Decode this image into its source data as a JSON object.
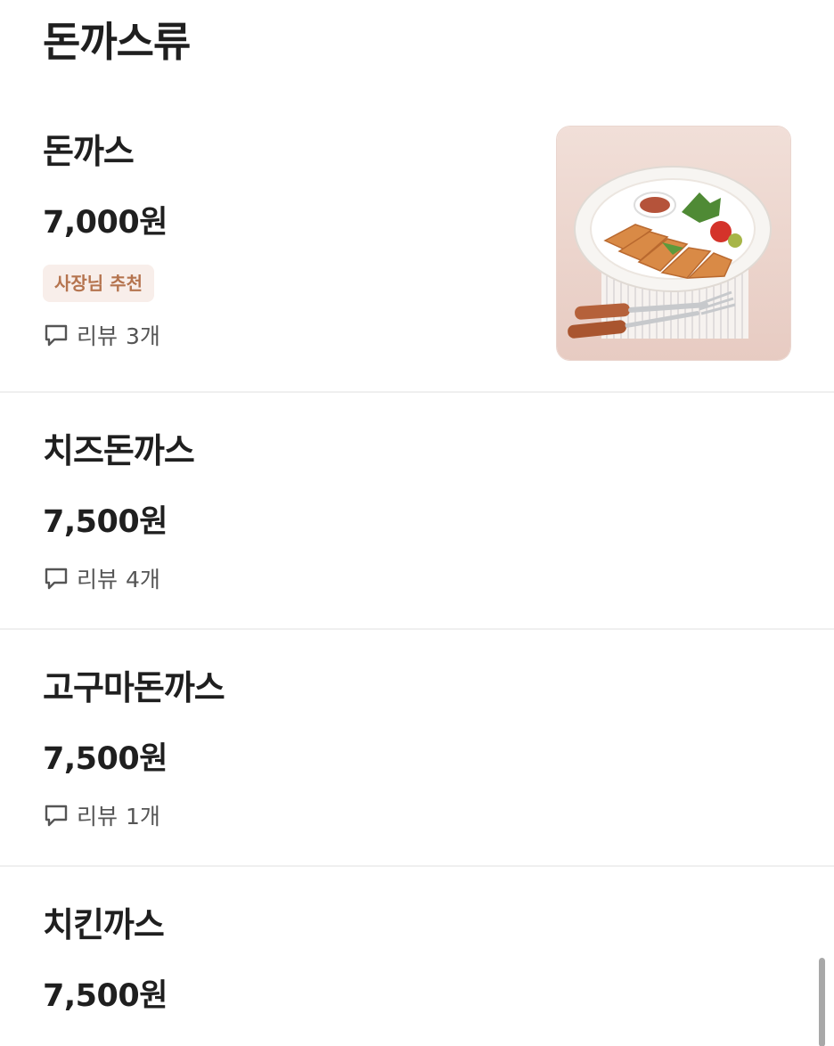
{
  "category": {
    "title": "돈까스류"
  },
  "menu_items": [
    {
      "name": "돈까스",
      "price": "7,000원",
      "badge": "사장님 추천",
      "review_word": "리뷰",
      "review_count": "3개",
      "image_subject": "pork-cutlet-plate-photo"
    },
    {
      "name": "치즈돈까스",
      "price": "7,500원",
      "review_word": "리뷰",
      "review_count": "4개"
    },
    {
      "name": "고구마돈까스",
      "price": "7,500원",
      "review_word": "리뷰",
      "review_count": "1개"
    },
    {
      "name": "치킨까스",
      "price": "7,500원"
    }
  ],
  "icons": {
    "review": "speech-bubble-icon"
  },
  "colors": {
    "badge_background": "#f8eeea",
    "badge_text": "#b5744f",
    "divider": "#efefef",
    "text_primary": "#1f1f1f",
    "text_secondary": "#555555",
    "scrollbar": "#a8a8a8"
  }
}
